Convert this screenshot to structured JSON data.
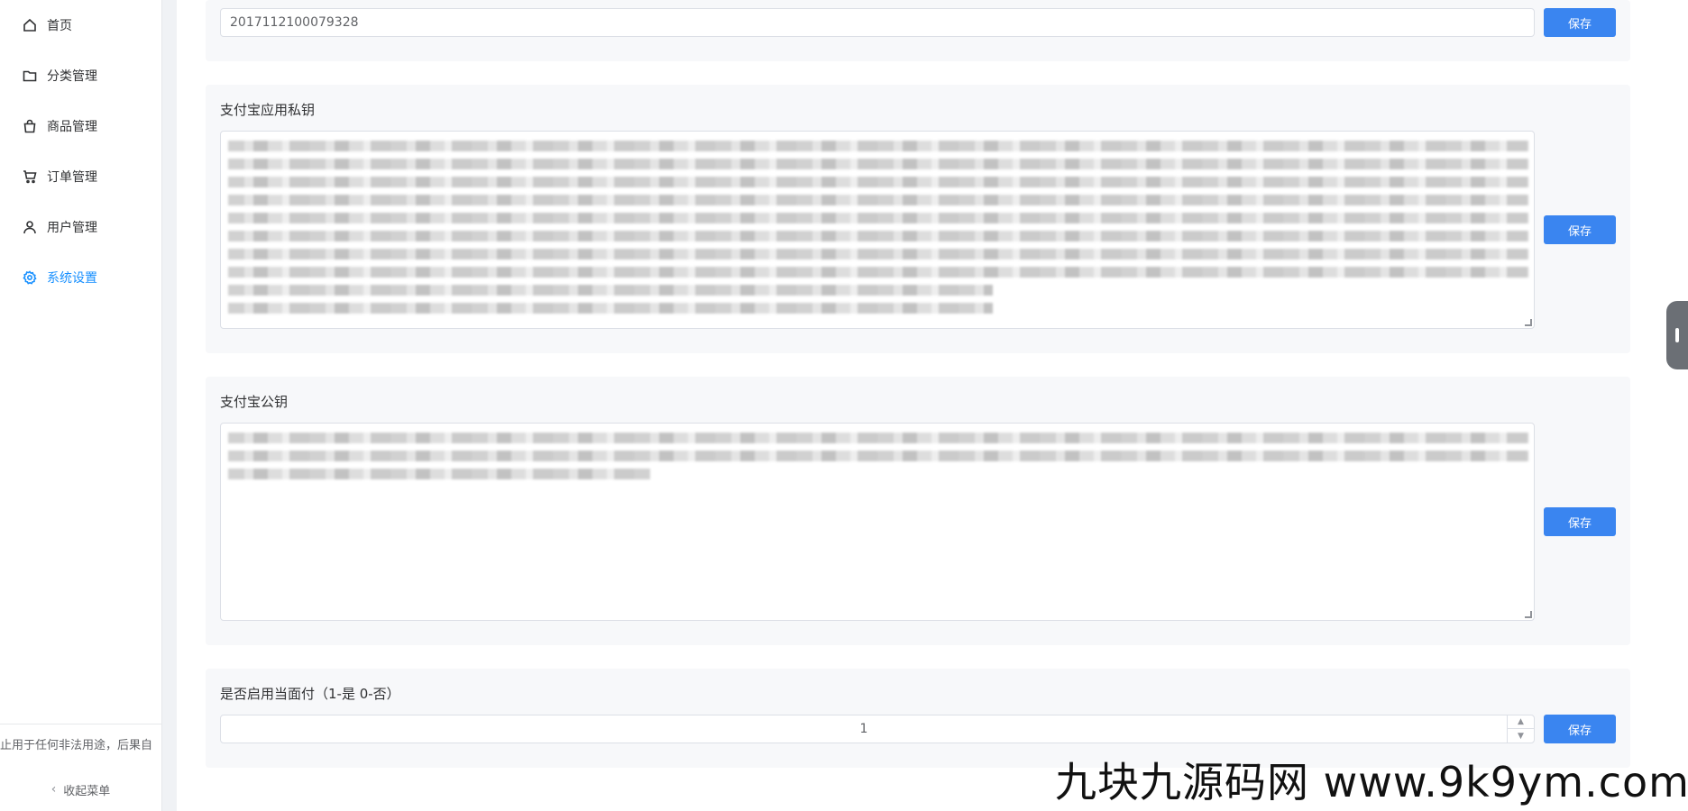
{
  "sidebar": {
    "items": [
      {
        "label": "首页",
        "icon": "home-icon"
      },
      {
        "label": "分类管理",
        "icon": "folder-icon"
      },
      {
        "label": "商品管理",
        "icon": "bag-icon"
      },
      {
        "label": "订单管理",
        "icon": "cart-icon"
      },
      {
        "label": "用户管理",
        "icon": "user-icon"
      },
      {
        "label": "系统设置",
        "icon": "gear-icon",
        "active": true
      }
    ],
    "notice": "止用于任何非法用途，后果自",
    "collapse_label": "收起菜单",
    "active_color": "#1890ff"
  },
  "settings": {
    "app_id": {
      "value": "2017112100079328",
      "save_label": "保存"
    },
    "private_key": {
      "label": "支付宝应用私钥",
      "save_label": "保存"
    },
    "public_key": {
      "label": "支付宝公钥",
      "save_label": "保存"
    },
    "face_pay": {
      "label": "是否启用当面付（1-是 0-否）",
      "value": "1",
      "save_label": "保存"
    }
  },
  "watermark": "九块九源码网 www.9k9ym.com",
  "colors": {
    "primary_button": "#3a85f0",
    "card_bg": "#f7f8fa"
  }
}
